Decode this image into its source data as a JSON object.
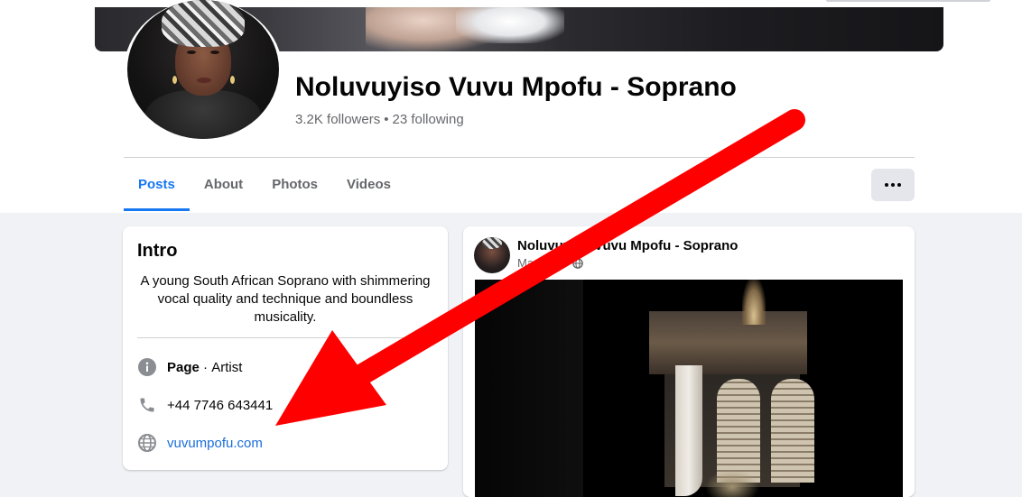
{
  "profile": {
    "name": "Noluvuyiso Vuvu Mpofu - Soprano",
    "followers": "3.2K followers",
    "separator": "•",
    "following": "23 following"
  },
  "tabs": [
    {
      "label": "Posts",
      "active": true
    },
    {
      "label": "About",
      "active": false
    },
    {
      "label": "Photos",
      "active": false
    },
    {
      "label": "Videos",
      "active": false
    }
  ],
  "more_button": {
    "icon": "more-horizontal-icon"
  },
  "intro": {
    "title": "Intro",
    "bio": "A young South African Soprano with shimmering vocal quality and technique and boundless musicality.",
    "page_type_label": "Page",
    "page_type_sep": " · ",
    "page_category": "Artist",
    "phone": "+44 7746 643441",
    "website": "vuvumpofu.com",
    "icons": [
      "info-icon",
      "phone-icon",
      "globe-icon"
    ]
  },
  "post": {
    "author": "Noluvuyiso Vuvu Mpofu - Soprano",
    "date": "Ma 2024",
    "date_sep": "·",
    "audience_icon": "globe-icon"
  },
  "colors": {
    "accent": "#1877f2",
    "link": "#1a6ed8",
    "arrow": "#ff0000",
    "page_bg": "#f0f2f5",
    "secondary_text": "#65676b"
  },
  "annotation": {
    "type": "red-arrow",
    "points_to": "website"
  }
}
